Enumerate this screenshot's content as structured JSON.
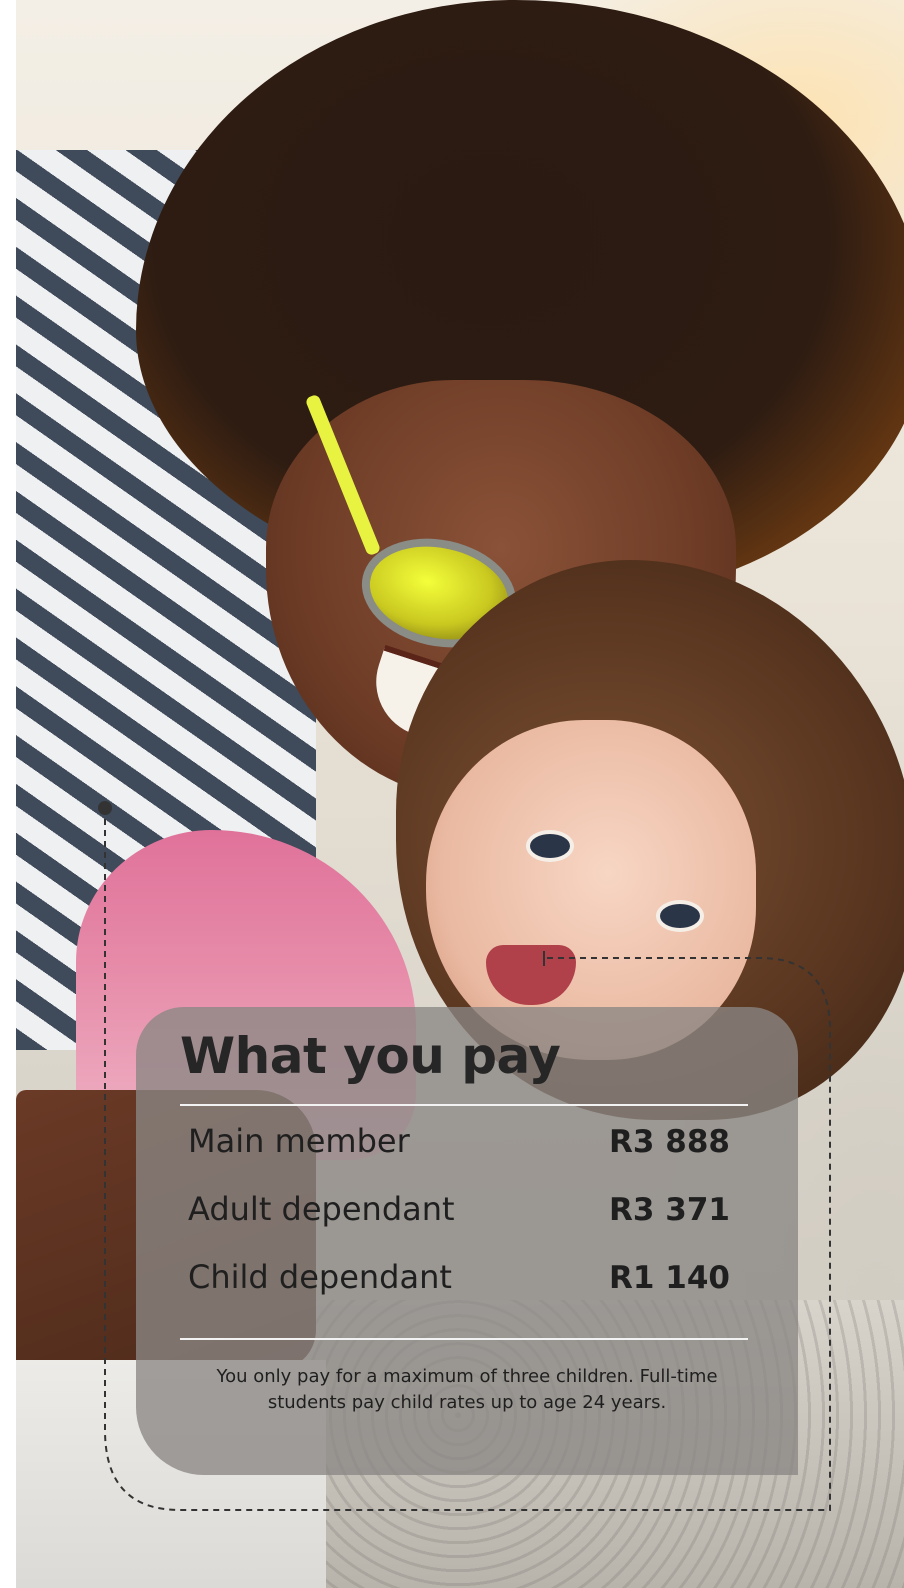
{
  "card": {
    "title": "What you pay",
    "rows": [
      {
        "label": "Main member",
        "value": "R3 888"
      },
      {
        "label": "Adult dependant",
        "value": "R3 371"
      },
      {
        "label": "Child dependant",
        "value": "R1 140"
      }
    ],
    "note_line1": "You only pay for a maximum of three children. Full-time",
    "note_line2": "students pay child rates up to age 24 years."
  },
  "colors": {
    "card_background": "#8a8784",
    "text": "#222222",
    "rule": "#f2f2f2",
    "dashed_line": "#333333"
  },
  "photo": {
    "icon": "family-photo"
  }
}
